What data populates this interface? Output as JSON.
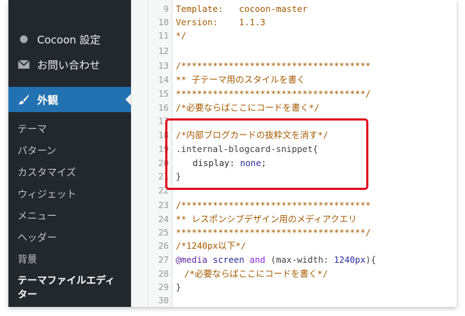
{
  "sidebar": {
    "cocoon_label": "Cocoon 設定",
    "contact_label": "お問い合わせ",
    "appearance_label": "外観",
    "submenu": [
      "テーマ",
      "パターン",
      "カスタマイズ",
      "ウィジェット",
      "メニュー",
      "ヘッダー",
      "背景"
    ],
    "current_item": "テーマファイルエディター"
  },
  "editor": {
    "lines": [
      {
        "n": "9",
        "text": "Template:   cocoon-master"
      },
      {
        "n": "10",
        "text": "Version:    1.1.3"
      },
      {
        "n": "11",
        "text": "*/"
      },
      {
        "n": "12",
        "text": ""
      },
      {
        "n": "13",
        "text": "/************************************"
      },
      {
        "n": "14",
        "text": "** 子テーマ用のスタイルを書く"
      },
      {
        "n": "15",
        "text": "************************************/"
      },
      {
        "n": "16",
        "text": "/*必要ならばここにコードを書く*/"
      },
      {
        "n": "17",
        "text": ""
      },
      {
        "n": "18",
        "text": "/*内部ブログカードの抜粋文を消す*/"
      },
      {
        "n": "19",
        "text": ".internal-blogcard-snippet{"
      },
      {
        "n": "20",
        "prop": "display",
        "value": "none"
      },
      {
        "n": "21",
        "text": "}"
      },
      {
        "n": "22",
        "text": ""
      },
      {
        "n": "23",
        "text": "/************************************"
      },
      {
        "n": "24",
        "text": "** レスポンシブデザイン用のメディアクエリ"
      },
      {
        "n": "25",
        "text": "************************************/"
      },
      {
        "n": "26",
        "text": "/*1240px以下*/"
      },
      {
        "n": "27",
        "at": "@media",
        "media_type": "screen",
        "and": "and",
        "feature": "(max-width: ",
        "feature_value": "1240px",
        "close": "){"
      },
      {
        "n": "28",
        "text": "/*必要ならばここにコードを書く*/"
      },
      {
        "n": "29",
        "text": "}"
      },
      {
        "n": "30",
        "text": ""
      }
    ]
  },
  "colors": {
    "sidebar_bg": "#23282d",
    "active_bg": "#2271b1",
    "highlight_border": "#e2001a",
    "comment": "#a55a00"
  }
}
